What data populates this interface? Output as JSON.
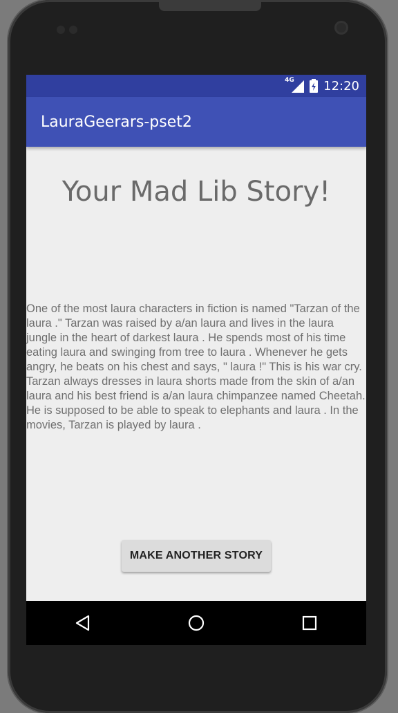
{
  "status_bar": {
    "network": "4G",
    "time": "12:20",
    "icons": [
      "signal-icon",
      "battery-icon"
    ]
  },
  "app_bar": {
    "title": "LauraGeerars-pset2"
  },
  "main": {
    "heading": "Your Mad Lib Story!",
    "story": "One of the most laura characters in fiction is named \"Tarzan of the laura .\" Tarzan was raised by a/an laura and lives in the laura jungle in the heart of darkest laura . He spends most of his time eating laura and swinging from tree to laura . Whenever he gets angry, he beats on his chest and says, \" laura !\" This is his war cry. Tarzan always dresses in laura shorts made from the skin of a/an laura and his best friend is a/an laura chimpanzee named Cheetah. He is supposed to be able to speak to elephants and laura . In the movies, Tarzan is played by laura .",
    "button_label": "MAKE ANOTHER STORY"
  },
  "nav_bar": {
    "icons": [
      "back-icon",
      "home-icon",
      "recents-icon"
    ]
  },
  "colors": {
    "status_bar": "#303f9f",
    "app_bar": "#3f51b5",
    "background": "#eeeeee"
  }
}
